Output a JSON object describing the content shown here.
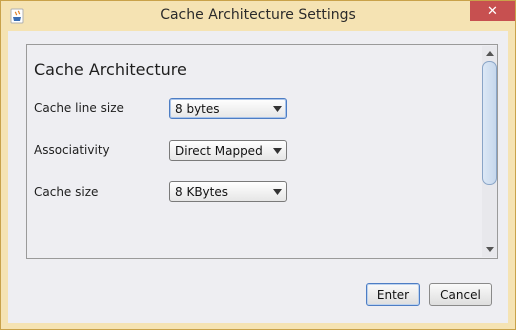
{
  "window": {
    "title": "Cache Architecture Settings",
    "close_label": "✕"
  },
  "panel": {
    "title": "Cache Architecture",
    "rows": [
      {
        "label": "Cache line size",
        "value": "8 bytes"
      },
      {
        "label": "Associativity",
        "value": "Direct Mapped"
      },
      {
        "label": "Cache size",
        "value": "8 KBytes"
      }
    ]
  },
  "buttons": {
    "enter_label": "Enter",
    "cancel_label": "Cancel"
  },
  "icons": {
    "app": "java-cup-icon",
    "close": "close-icon",
    "dropdown": "chevron-down-icon",
    "scroll_up": "scroll-up-arrow-icon",
    "scroll_down": "scroll-down-arrow-icon"
  },
  "colors": {
    "title_bar": "#f5e3b3",
    "close_button": "#c75050",
    "focus_border": "#4d7dc4",
    "dialog_bg": "#eeeef2"
  }
}
